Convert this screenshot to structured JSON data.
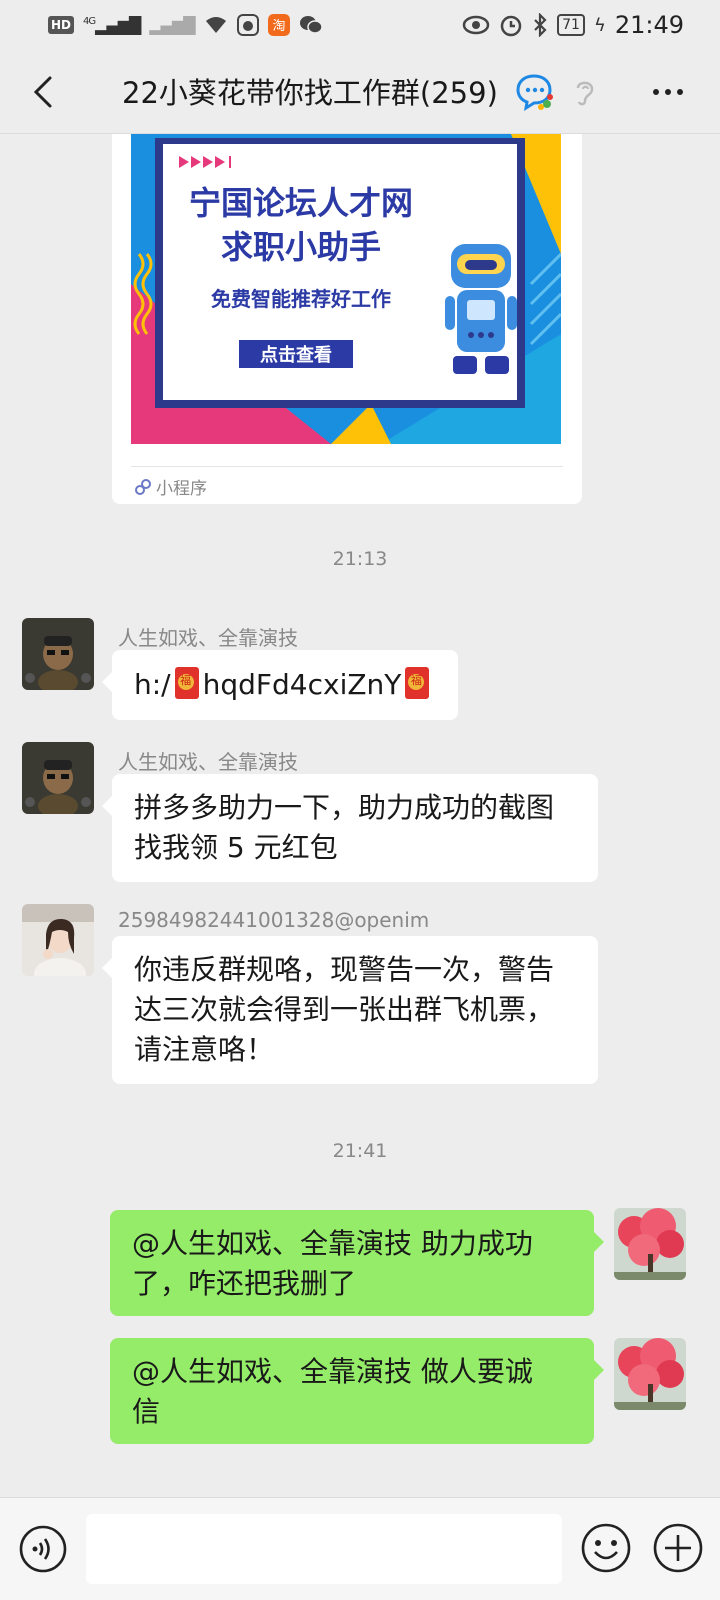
{
  "status_bar": {
    "net_badge": "HD",
    "net_type": "4G",
    "battery": "71",
    "time": "21:49"
  },
  "header": {
    "title": "22小葵花带你找工作群(259)",
    "back_icon": "chevron-left-icon",
    "more_icon": "more-dots-icon"
  },
  "mini_program": {
    "banner_title_line1": "宁国论坛人才网",
    "banner_title_line2": "求职小助手",
    "banner_subtitle": "免费智能推荐好工作",
    "banner_button": "点击查看",
    "footer_label": "小程序"
  },
  "messages": {
    "ts1": "21:13",
    "m1_sender": "人生如戏、全靠演技",
    "m1_pre": "h:/",
    "m1_code": "hqdFd4cxiZnY",
    "m2_sender": "人生如戏、全靠演技",
    "m2_line1": "拼多多助力一下，助力成功的截图",
    "m2_line2": "找我领 5 元红包",
    "m3_sender": "25984982441001328@openim",
    "m3_line1": "你违反群规咯，现警告一次，警告",
    "m3_line2": "达三次就会得到一张出群飞机票，",
    "m3_line3": "请注意咯！",
    "ts2": "21:41",
    "m4_line1": "@人生如戏、全靠演技  助力成功",
    "m4_line2": "了，咋还把我删了",
    "m5_line1": "@人生如戏、全靠演技  做人要诚",
    "m5_line2": "信"
  },
  "input_bar": {
    "voice_icon": "voice-icon",
    "emoji_icon": "emoji-icon",
    "plus_icon": "plus-icon"
  },
  "colors": {
    "outgoing_bubble": "#95ec69",
    "incoming_bubble": "#ffffff",
    "background": "#ededed"
  }
}
